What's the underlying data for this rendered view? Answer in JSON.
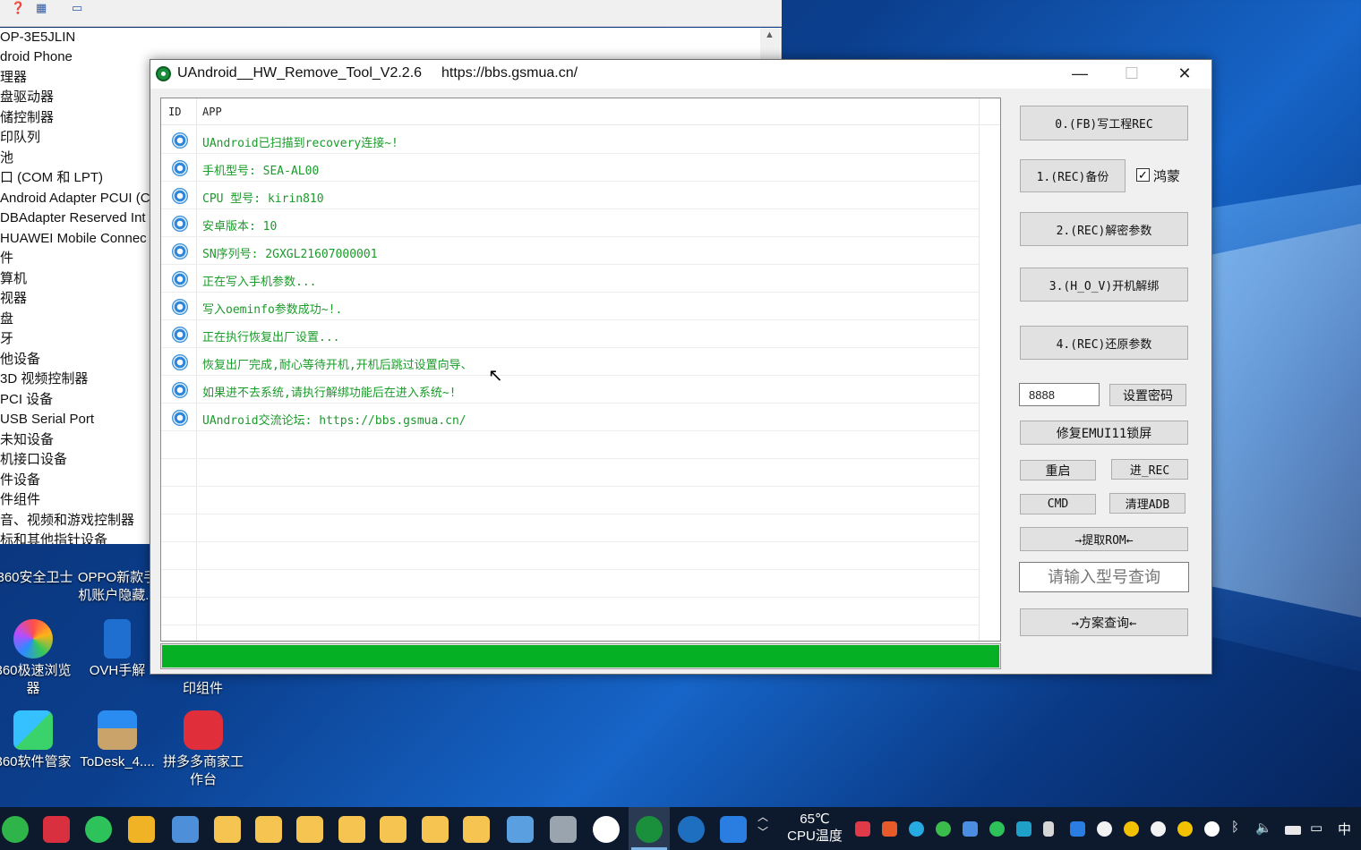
{
  "devmgr": {
    "tree": [
      "OP-3E5JLIN",
      "droid Phone",
      "理器",
      "盘驱动器",
      "储控制器",
      "印队列",
      "池",
      "口 (COM 和 LPT)",
      " Android Adapter PCUI (C",
      " DBAdapter Reserved Int",
      " HUAWEI Mobile Connec",
      "件",
      "算机",
      "视器",
      "盘",
      "牙",
      "他设备",
      " 3D 视频控制器",
      " PCI 设备",
      " USB Serial Port",
      " 未知设备",
      "机接口设备",
      "件设备",
      "件组件",
      "音、视频和游戏控制器",
      "标和其他指针设备"
    ]
  },
  "desktop": {
    "icons": [
      {
        "label": "360安全卫士",
        "icon": "360-safe-icon"
      },
      {
        "label": "OPPO新款手机账户隐藏...",
        "icon": "oppo-doc-icon"
      },
      {
        "label": "360极速浏览器",
        "icon": "360-browser-icon"
      },
      {
        "label": "OVH手解",
        "icon": "ovh-tool-icon"
      },
      {
        "label": "印组件",
        "icon": "print-component-icon"
      },
      {
        "label": "360软件管家",
        "icon": "360-softmgr-icon"
      },
      {
        "label": "ToDesk_4....",
        "icon": "todesk-icon"
      },
      {
        "label": "拼多多商家工作台",
        "icon": "pdd-merchant-icon"
      }
    ]
  },
  "window": {
    "title": "UAndroid__HW_Remove_Tool_V2.2.6",
    "url": "https://bbs.gsmua.cn/",
    "minimize": "—",
    "maximize": "☐",
    "close": "✕"
  },
  "log": {
    "columns": [
      "ID",
      "APP"
    ],
    "rows": [
      "UAndroid已扫描到recovery连接~!",
      "手机型号: SEA-AL00",
      "CPU 型号: kirin810",
      "安卓版本: 10",
      "SN序列号: 2GXGL21607000001",
      "正在写入手机参数...",
      "写入oeminfo参数成功~!.",
      "正在执行恢复出厂设置...",
      "恢复出厂完成,耐心等待开机,开机后跳过设置向导、",
      "如果进不去系统,请执行解绑功能后在进入系统~!",
      "UAndroid交流论坛: https://bbs.gsmua.cn/"
    ],
    "progress": 1.0,
    "progress_color": "#06b025"
  },
  "controls": {
    "btn0": "0.(FB)写工程REC",
    "btn1": "1.(REC)备份",
    "hongmeng_label": "鸿蒙",
    "hongmeng_checked": "✓",
    "btn2": "2.(REC)解密参数",
    "btn3": "3.(H_O_V)开机解绑",
    "btn4": "4.(REC)还原参数",
    "password_value": "8888",
    "set_password": "设置密码",
    "fix_emui": "修复EMUI11锁屏",
    "reboot": "重启",
    "enter_rec": "进_REC",
    "cmd": "CMD",
    "clean_adb": "清理ADB",
    "extract_rom": "→提取ROM←",
    "model_query_placeholder": "请输入型号查询",
    "solution_query": "→方案查询←"
  },
  "taskbar": {
    "cpu_temp": "65℃",
    "cpu_label": "CPU温度",
    "ime": "中"
  }
}
